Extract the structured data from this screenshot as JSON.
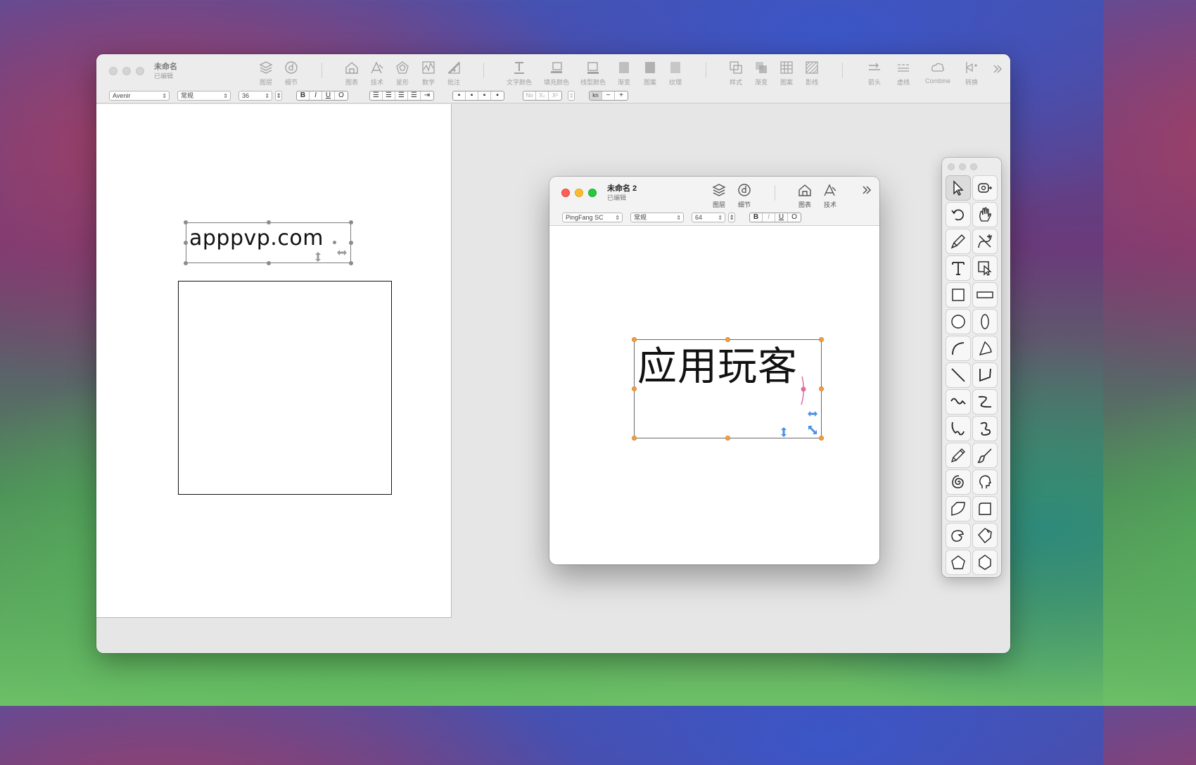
{
  "main_window": {
    "title": "未命名",
    "subtitle": "已编辑",
    "toolbar": [
      {
        "label": "图层",
        "icon": "layers-icon"
      },
      {
        "label": "细节",
        "icon": "details-icon"
      },
      {
        "label": "图表",
        "icon": "chart-house-icon"
      },
      {
        "label": "技术",
        "icon": "technical-icon"
      },
      {
        "label": "星形",
        "icon": "star-icon"
      },
      {
        "label": "数学",
        "icon": "math-icon"
      },
      {
        "label": "批注",
        "icon": "annotation-icon"
      },
      {
        "label": "文字颜色",
        "icon": "text-color-icon"
      },
      {
        "label": "填充颜色",
        "icon": "fill-color-icon"
      },
      {
        "label": "线型颜色",
        "icon": "stroke-color-icon"
      },
      {
        "label": "渐变",
        "icon": "gradient-icon"
      },
      {
        "label": "图案",
        "icon": "pattern-icon"
      },
      {
        "label": "纹理",
        "icon": "texture-icon"
      },
      {
        "label": "样式",
        "icon": "style-icon"
      },
      {
        "label": "渐变",
        "icon": "blend-icon"
      },
      {
        "label": "图案",
        "icon": "grid-pattern-icon"
      },
      {
        "label": "影线",
        "icon": "hatch-icon"
      },
      {
        "label": "箭头",
        "icon": "arrow-icon"
      },
      {
        "label": "虚线",
        "icon": "dash-icon"
      },
      {
        "label": "Combine",
        "icon": "combine-icon"
      },
      {
        "label": "转换",
        "icon": "transform-icon"
      }
    ],
    "format": {
      "font": "Avenir",
      "style": "常规",
      "size": "36",
      "bold": "B",
      "italic": "I",
      "underline": "U",
      "outline": "O",
      "script": [
        "No",
        "X₂",
        "X²"
      ],
      "kern": [
        "kn",
        "−",
        "+"
      ]
    },
    "canvas": {
      "text_object": "apppvp.com"
    }
  },
  "second_window": {
    "title": "未命名 2",
    "subtitle": "已编辑",
    "toolbar": [
      {
        "label": "图层",
        "icon": "layers-icon"
      },
      {
        "label": "细节",
        "icon": "details-icon"
      },
      {
        "label": "图表",
        "icon": "chart-house-icon"
      },
      {
        "label": "技术",
        "icon": "technical-icon"
      }
    ],
    "format": {
      "font": "PingFang SC",
      "style": "常规",
      "size": "64",
      "bold": "B",
      "italic": "I",
      "underline": "U",
      "outline": "O"
    },
    "canvas": {
      "text_object": "应用玩客"
    }
  },
  "palette": {
    "tools": [
      "select-arrow-icon",
      "tape-measure-icon",
      "rotate-icon",
      "hand-icon",
      "pen-knife-icon",
      "add-point-icon",
      "text-tool-icon",
      "zoom-select-icon",
      "square-icon",
      "wide-rect-icon",
      "circle-icon",
      "ellipse-icon",
      "arc-icon",
      "pie-icon",
      "line-icon",
      "polyline-icon",
      "wave-icon",
      "curve-icon",
      "freeform-icon",
      "loop-icon",
      "pencil-icon",
      "brush-icon",
      "spiral-icon",
      "head-icon",
      "quarter-round-icon",
      "rounded-rect-icon",
      "cloud-shape-icon",
      "tag-shape-icon",
      "pentagon-icon",
      "hexagon-icon"
    ]
  }
}
